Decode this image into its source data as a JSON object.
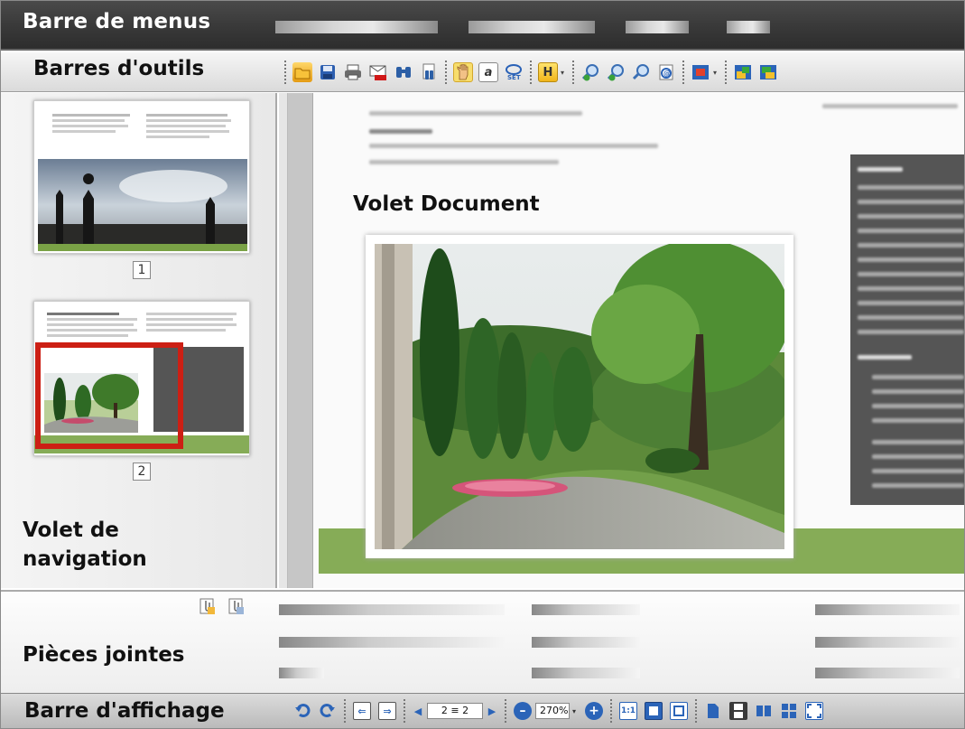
{
  "menu_bar": {
    "label": "Barre de menus"
  },
  "toolbars": {
    "label": "Barres d'outils",
    "icons": [
      "open-icon",
      "save-icon",
      "print-icon",
      "email-pdf-icon",
      "find-icon",
      "advanced-find-icon",
      "hand-tool-icon",
      "select-text-icon",
      "set-icon",
      "highlight-icon",
      "zoom-in-icon",
      "zoom-out-icon",
      "zoom-icon",
      "email-icon",
      "redact-icon",
      "prev-view-icon",
      "next-view-icon"
    ]
  },
  "navigation_pane": {
    "label_line1": "Volet de",
    "label_line2": "navigation",
    "thumbnails": [
      {
        "page": "1"
      },
      {
        "page": "2"
      }
    ]
  },
  "document_pane": {
    "label": "Volet Document"
  },
  "attachments": {
    "label": "Pièces jointes"
  },
  "display_bar": {
    "label": "Barre d'affichage",
    "page_field": "2 ≡ 2",
    "zoom_value": "270%"
  },
  "colors": {
    "accent_green": "#86ac57",
    "menu_dark": "#3a3a3a",
    "selection_red": "#cc1f14",
    "tool_active": "#f7dd6c"
  }
}
